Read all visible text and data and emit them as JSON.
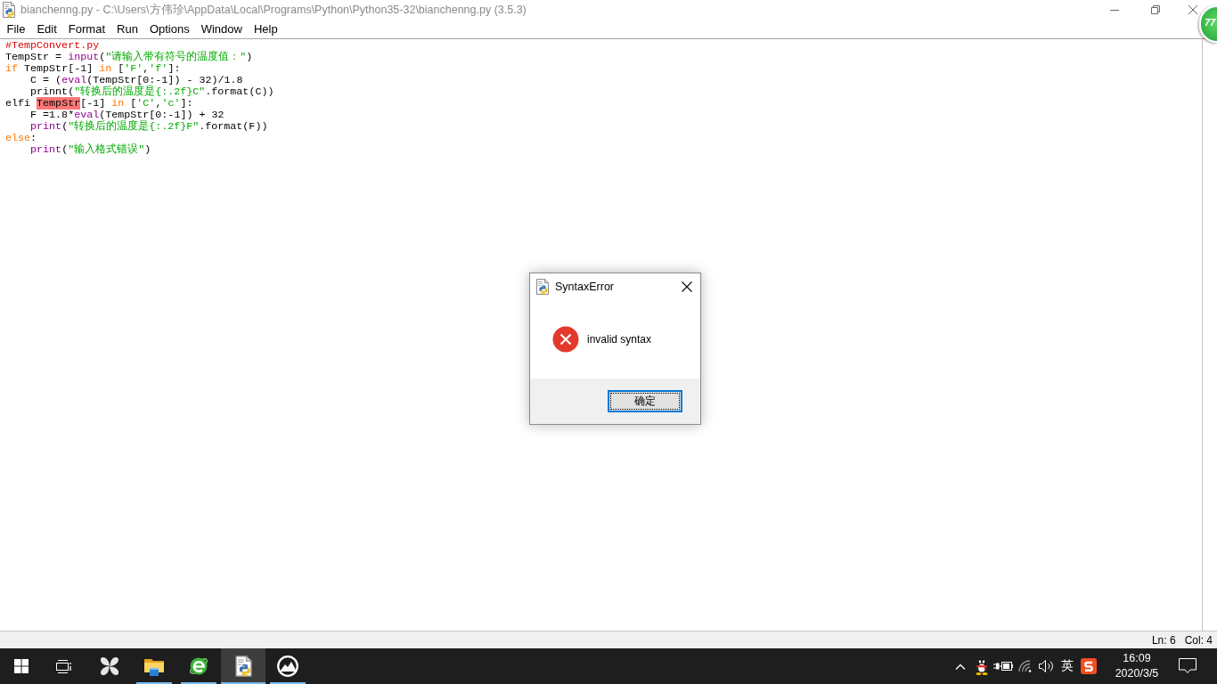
{
  "window": {
    "title": "bianchenng.py - C:\\Users\\方伟珍\\AppData\\Local\\Programs\\Python\\Python35-32\\bianchenng.py (3.5.3)"
  },
  "floating_ball": {
    "label": "77"
  },
  "menu": [
    {
      "label": "File"
    },
    {
      "label": "Edit"
    },
    {
      "label": "Format"
    },
    {
      "label": "Run"
    },
    {
      "label": "Options"
    },
    {
      "label": "Window"
    },
    {
      "label": "Help"
    }
  ],
  "editor": {
    "lines": [
      {
        "tokens": [
          {
            "kind": "comment",
            "text": "#TempConvert.py"
          }
        ]
      },
      {
        "tokens": [
          {
            "kind": "plain",
            "text": "TempStr = "
          },
          {
            "kind": "builtin",
            "text": "input"
          },
          {
            "kind": "plain",
            "text": "("
          },
          {
            "kind": "string",
            "text": "\"请输入带有符号的温度值：\""
          },
          {
            "kind": "plain",
            "text": ")"
          }
        ]
      },
      {
        "tokens": [
          {
            "kind": "keyword",
            "text": "if"
          },
          {
            "kind": "plain",
            "text": " TempStr[-1] "
          },
          {
            "kind": "keyword",
            "text": "in"
          },
          {
            "kind": "plain",
            "text": " ["
          },
          {
            "kind": "string",
            "text": "'F'"
          },
          {
            "kind": "plain",
            "text": ","
          },
          {
            "kind": "string",
            "text": "'f'"
          },
          {
            "kind": "plain",
            "text": "]:"
          }
        ],
        "children": [
          {
            "tokens": [
              {
                "kind": "plain",
                "text": "C = ("
              },
              {
                "kind": "builtin",
                "text": "eval"
              },
              {
                "kind": "plain",
                "text": "(TempStr[0:-1]) - 32)/1.8"
              }
            ]
          },
          {
            "tokens": [
              {
                "kind": "plain",
                "text": "prinnt("
              },
              {
                "kind": "string",
                "text": "\"转换后的温度是{:.2f}C\""
              },
              {
                "kind": "plain",
                "text": ".format(C))"
              }
            ]
          }
        ]
      },
      {
        "tokens": [
          {
            "kind": "plain",
            "text": "elfi "
          },
          {
            "kind": "error",
            "text": "TempStr"
          },
          {
            "kind": "plain",
            "text": "[-1] "
          },
          {
            "kind": "keyword",
            "text": "in"
          },
          {
            "kind": "plain",
            "text": " ["
          },
          {
            "kind": "string",
            "text": "'C'"
          },
          {
            "kind": "plain",
            "text": ","
          },
          {
            "kind": "string",
            "text": "'c'"
          },
          {
            "kind": "plain",
            "text": "]:"
          }
        ],
        "children": [
          {
            "tokens": [
              {
                "kind": "plain",
                "text": "F =1.8*"
              },
              {
                "kind": "builtin",
                "text": "eval"
              },
              {
                "kind": "plain",
                "text": "(TempStr[0:-1]) + 32"
              }
            ]
          },
          {
            "tokens": [
              {
                "kind": "builtin",
                "text": "print"
              },
              {
                "kind": "plain",
                "text": "("
              },
              {
                "kind": "string",
                "text": "\"转换后的温度是{:.2f}F\""
              },
              {
                "kind": "plain",
                "text": ".format(F))"
              }
            ]
          }
        ]
      },
      {
        "tokens": [
          {
            "kind": "keyword",
            "text": "else"
          },
          {
            "kind": "plain",
            "text": ":"
          }
        ],
        "children": [
          {
            "tokens": [
              {
                "kind": "builtin",
                "text": "print"
              },
              {
                "kind": "plain",
                "text": "("
              },
              {
                "kind": "string",
                "text": "\"输入格式错误\""
              },
              {
                "kind": "plain",
                "text": ")"
              }
            ]
          }
        ]
      }
    ]
  },
  "status_bar": {
    "line": "Ln: 6",
    "column": "Col: 4"
  },
  "dialog": {
    "title": "SyntaxError",
    "message": "invalid syntax",
    "button": "确定"
  },
  "taskbar": {
    "apps": [
      {
        "kind": "pinwheel",
        "running": false,
        "selected": false
      },
      {
        "kind": "folder",
        "running": true,
        "selected": false
      },
      {
        "kind": "browser",
        "running": true,
        "selected": false
      },
      {
        "kind": "python",
        "running": true,
        "selected": true
      },
      {
        "kind": "mountain",
        "running": true,
        "selected": false
      }
    ],
    "input_mode": "英",
    "clock": {
      "time": "16:09",
      "date": "2020/3/5"
    }
  }
}
